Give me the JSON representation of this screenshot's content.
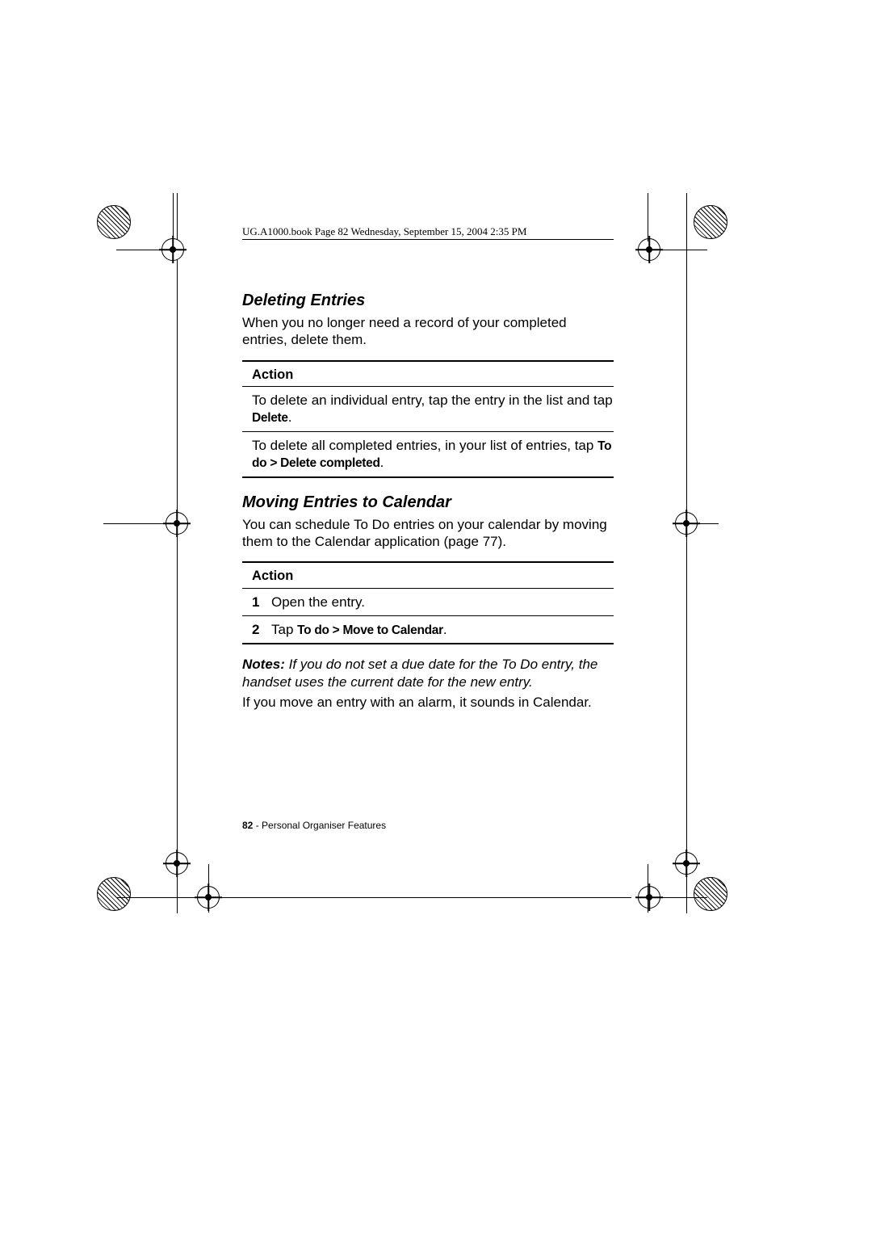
{
  "header": "UG.A1000.book  Page 82  Wednesday, September 15, 2004  2:35 PM",
  "section1": {
    "title": "Deleting Entries",
    "intro": "When you no longer need a record of your completed entries, delete them.",
    "action_head": "Action",
    "row1_pre": "To delete an individual entry, tap the entry in the list and tap ",
    "row1_bold": "Delete",
    "row1_post": ".",
    "row2_pre": "To delete all completed entries, in your list of entries, tap ",
    "row2_bold1": "To do",
    "row2_mid": " > ",
    "row2_bold2": "Delete completed",
    "row2_post": "."
  },
  "section2": {
    "title": "Moving Entries to Calendar",
    "intro": "You can schedule To Do entries on your calendar by moving them to the Calendar application (page 77).",
    "action_head": "Action",
    "step1_num": "1",
    "step1_txt": "Open the entry.",
    "step2_num": "2",
    "step2_pre": "Tap ",
    "step2_bold1": "To do",
    "step2_mid": " > ",
    "step2_bold2": "Move to Calendar",
    "step2_post": ".",
    "notes_label": "Notes: ",
    "notes_body": "If you do not set a due date for the To Do entry, the handset uses the current date for the new entry.",
    "after": "If you move an entry with an alarm, it sounds in Calendar."
  },
  "footer": {
    "page": "82",
    "sep": " - ",
    "title": "Personal Organiser Features"
  }
}
